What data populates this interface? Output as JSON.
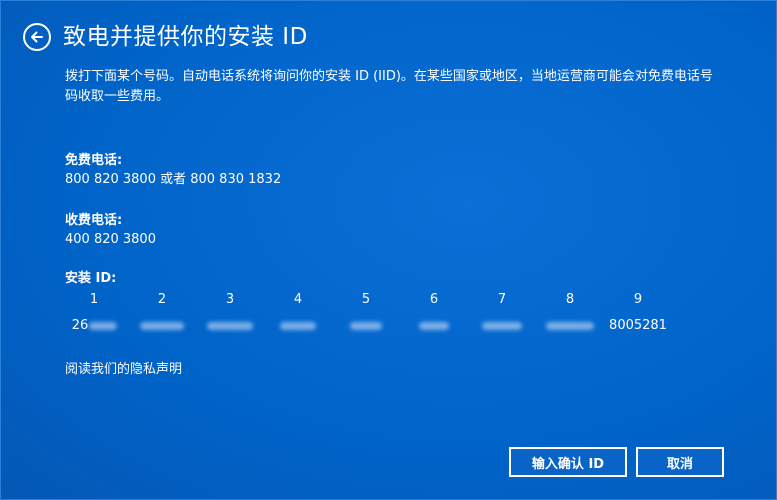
{
  "header": {
    "title": "致电并提供你的安装 ID",
    "back_icon": "arrow-left-icon"
  },
  "description": "拨打下面某个号码。自动电话系统将询问你的安装 ID (IID)。在某些国家或地区，当地运营商可能会对免费电话号码收取一些费用。",
  "tollfree": {
    "label": "免费电话:",
    "numbers": "800 820 3800 或者 800 830 1832"
  },
  "paid": {
    "label": "收费电话:",
    "numbers": "400 820 3800"
  },
  "installation_id": {
    "label": "安装 ID:",
    "columns": [
      "1",
      "2",
      "3",
      "4",
      "5",
      "6",
      "7",
      "8",
      "9"
    ],
    "first_segment_visible": "26",
    "last_segment": "8005281"
  },
  "privacy_link": "阅读我们的隐私声明",
  "buttons": {
    "confirm": "输入确认 ID",
    "cancel": "取消"
  },
  "colors": {
    "background": "#0063c8",
    "text": "#ffffff"
  }
}
